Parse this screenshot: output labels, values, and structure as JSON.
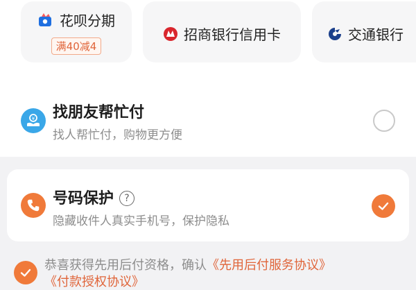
{
  "payment_options": [
    {
      "label": "花呗分期",
      "promo": "满40减4",
      "icon": "huabei-icon"
    },
    {
      "label": "招商银行信用卡",
      "icon": "cmb-bank-icon"
    },
    {
      "label": "交通银行",
      "icon": "bocom-bank-icon"
    }
  ],
  "friend_pay": {
    "title": "找朋友帮忙付",
    "subtitle": "找人帮忙付，购物更方便",
    "selected": false
  },
  "number_protect": {
    "title": "号码保护",
    "subtitle": "隐藏收件人真实手机号，保护隐私",
    "selected": true
  },
  "agreement": {
    "text": "恭喜获得先用后付资格，确认",
    "link": "《先用后付服务协议》",
    "link2": "《付款授权协议》",
    "checked": true
  },
  "colors": {
    "accent": "#f07a3a",
    "promo": "#e0653a",
    "friend_icon": "#3aa7e8",
    "phone_icon": "#f07a3a"
  }
}
